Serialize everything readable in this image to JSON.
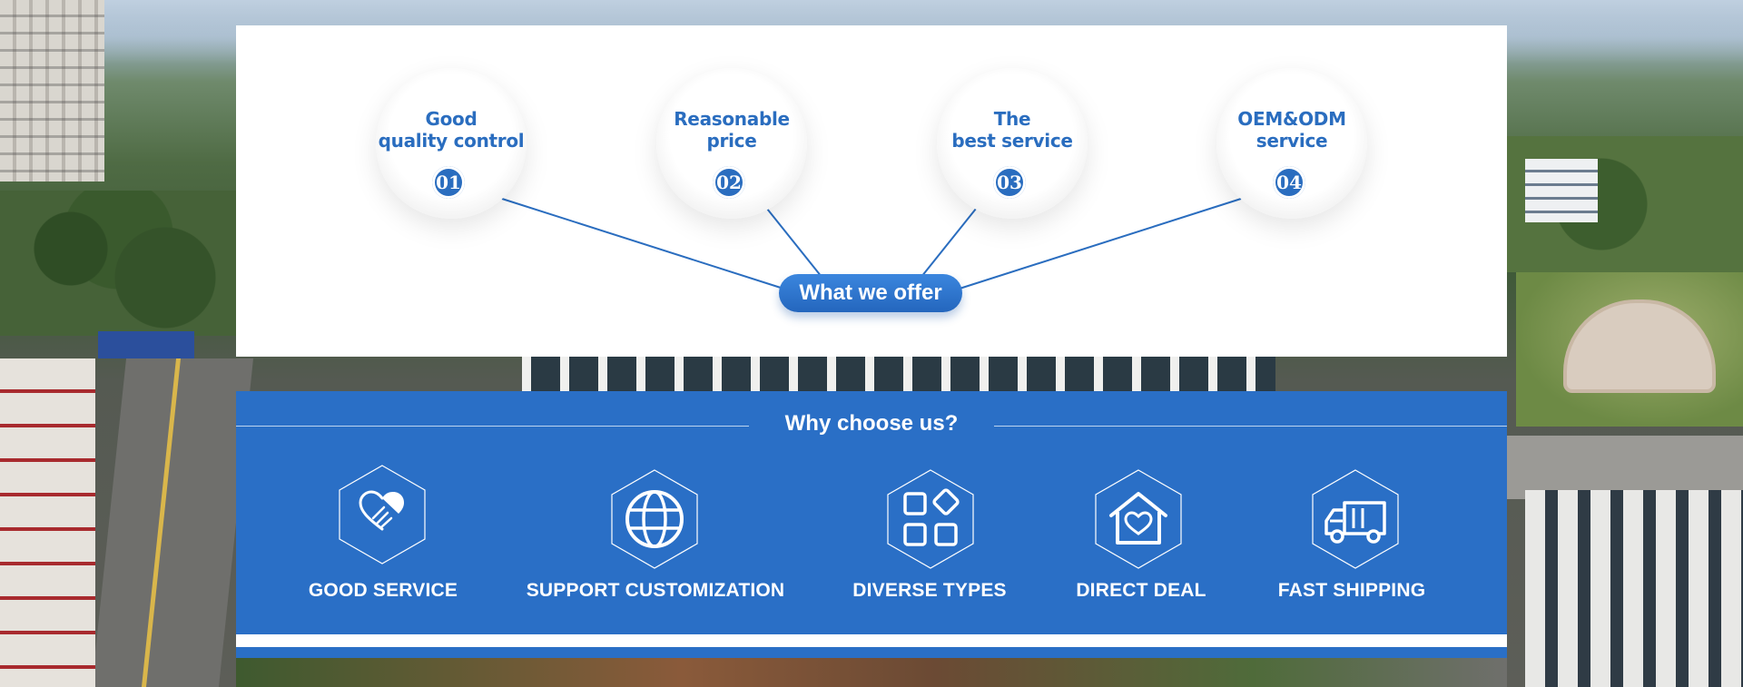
{
  "offer": {
    "pill_label": "What we offer",
    "items": [
      {
        "label": "Good\nquality control",
        "number": "01"
      },
      {
        "label": "Reasonable\nprice",
        "number": "02"
      },
      {
        "label": "The\nbest service",
        "number": "03"
      },
      {
        "label": "OEM&ODM\nservice",
        "number": "04"
      }
    ]
  },
  "why": {
    "title": "Why choose us?",
    "features": [
      {
        "label": "GOOD SERVICE",
        "icon": "handshake-heart-icon"
      },
      {
        "label": "SUPPORT CUSTOMIZATION",
        "icon": "globe-icon"
      },
      {
        "label": "DIVERSE TYPES",
        "icon": "apps-grid-icon"
      },
      {
        "label": "DIRECT DEAL",
        "icon": "house-heart-icon"
      },
      {
        "label": "FAST SHIPPING",
        "icon": "truck-icon"
      }
    ]
  },
  "colors": {
    "brand_blue": "#2a6fc6",
    "text_blue": "#2a6dbf",
    "white": "#ffffff"
  }
}
